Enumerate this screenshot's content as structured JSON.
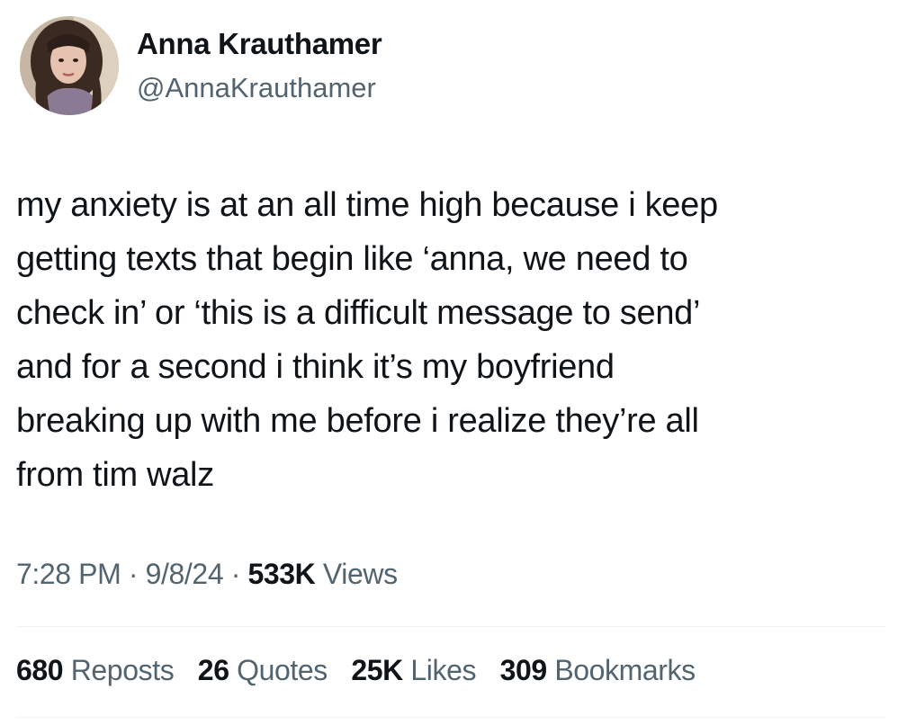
{
  "author": {
    "display_name": "Anna Krauthamer",
    "handle": "@AnnaKrauthamer",
    "avatar_icon": "profile-photo"
  },
  "tweet": {
    "text": "my anxiety is at an all time high because i keep\ngetting texts that begin like ‘anna, we need to\ncheck in’ or ‘this is a difficult message to send’\nand for a second i think it’s my boyfriend\nbreaking up with me before i realize they’re all\nfrom tim walz"
  },
  "meta": {
    "time": "7:28 PM",
    "separator": "·",
    "date": "9/8/24",
    "views_count": "533K",
    "views_label": "Views"
  },
  "stats": {
    "reposts_count": "680",
    "reposts_label": "Reposts",
    "quotes_count": "26",
    "quotes_label": "Quotes",
    "likes_count": "25K",
    "likes_label": "Likes",
    "bookmarks_count": "309",
    "bookmarks_label": "Bookmarks"
  },
  "colors": {
    "text": "#0f1419",
    "secondary": "#536471",
    "divider": "#eff3f4",
    "background": "#ffffff"
  }
}
